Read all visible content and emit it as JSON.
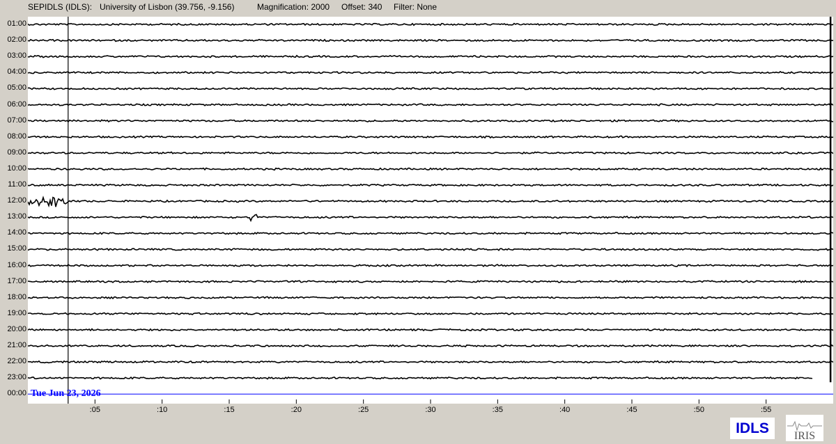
{
  "header": {
    "station": "SEPIDLS (IDLS):",
    "location": "University of Lisbon (39.756, -9.156)",
    "magnification": "Magnification: 2000",
    "offset": "Offset: 340",
    "filter": "Filter: None"
  },
  "date_label": "Tue Jun 23, 2026",
  "logos": {
    "station_code": "IDLS",
    "network": "IRIS"
  },
  "colors": {
    "trace": "#000000",
    "alt_trace": "#0000ff",
    "date": "#0000ff",
    "background": "#d4d0c8"
  },
  "chart_data": {
    "type": "line",
    "row_labels": [
      "01:00",
      "02:00",
      "03:00",
      "04:00",
      "05:00",
      "06:00",
      "07:00",
      "08:00",
      "09:00",
      "10:00",
      "11:00",
      "12:00",
      "13:00",
      "14:00",
      "15:00",
      "16:00",
      "17:00",
      "18:00",
      "19:00",
      "20:00",
      "21:00",
      "22:00",
      "23:00",
      "00:00"
    ],
    "x_ticks": [
      ":05",
      ":10",
      ":15",
      ":20",
      ":25",
      ":30",
      ":35",
      ":40",
      ":45",
      ":50",
      ":55"
    ],
    "x_tick_minutes": [
      5,
      10,
      15,
      20,
      25,
      30,
      35,
      40,
      45,
      50,
      55
    ],
    "xlim_minutes": [
      0,
      60
    ],
    "event_marker_minute": 3,
    "event": {
      "row_index": 11,
      "start_minute": 0,
      "end_minute": 3,
      "amplitude": 6
    },
    "secondary_event": {
      "row_index": 12,
      "minute": 16.8,
      "amplitude": 5
    },
    "last_trace_end_minute": 58.5,
    "data_end_minute": 59.8
  }
}
